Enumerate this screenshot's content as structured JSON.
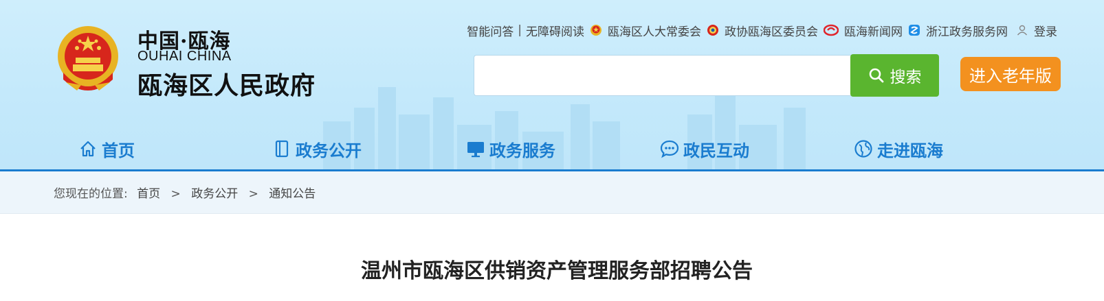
{
  "logo": {
    "top_text": "中国·瓯海",
    "english": "OUHAI CHINA",
    "main": "瓯海区人民政府"
  },
  "top_links": {
    "smart_qa": "智能问答",
    "separator": "|",
    "accessible": "无障碍阅读",
    "npc": "瓯海区人大常委会",
    "cppcc": "政协瓯海区委员会",
    "news": "瓯海新闻网",
    "zj_service": "浙江政务服务网",
    "login": "登录"
  },
  "search": {
    "placeholder": "",
    "value": "",
    "button_label": "搜索"
  },
  "elder_button": "进入老年版",
  "nav": [
    {
      "label": "首页",
      "icon": "home-icon"
    },
    {
      "label": "政务公开",
      "icon": "document-icon"
    },
    {
      "label": "政务服务",
      "icon": "monitor-icon"
    },
    {
      "label": "政民互动",
      "icon": "chat-icon"
    },
    {
      "label": "走进瓯海",
      "icon": "globe-icon"
    }
  ],
  "breadcrumb": {
    "prefix": "您现在的位置:",
    "items": [
      "首页",
      "政务公开",
      "通知公告"
    ],
    "separator": ">"
  },
  "article": {
    "title": "温州市瓯海区供销资产管理服务部招聘公告"
  },
  "colors": {
    "nav_blue": "#1a7ccf",
    "search_green": "#5ab52f",
    "elder_orange": "#f3911f",
    "header_bg": "#c4e9fb"
  }
}
